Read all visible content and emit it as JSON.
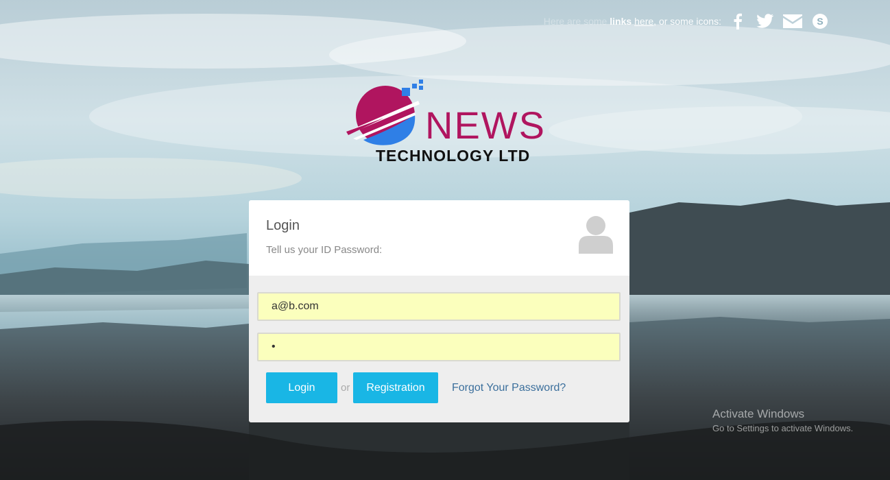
{
  "topnav": {
    "faded_text": "Here are some",
    "bold_text": "links",
    "link_text": "here",
    "rest_text": ", or some icons:",
    "icons": [
      "facebook-icon",
      "twitter-icon",
      "envelope-icon",
      "skype-icon"
    ]
  },
  "logo": {
    "word": "NEWS",
    "subtitle": "TECHNOLOGY LTD"
  },
  "login_card": {
    "title": "Login",
    "subtitle": "Tell us your ID Password:",
    "email_value": "a@b.com",
    "password_value": "•",
    "login_button": "Login",
    "or_text": "or",
    "registration_button": "Registration",
    "forgot_link": "Forgot Your Password?"
  },
  "watermark": {
    "title": "Activate Windows",
    "subtitle": "Go to Settings to activate Windows."
  },
  "colors": {
    "button": "#19b6e5",
    "input_bg": "#fbffbd",
    "brand_magenta": "#b0155f",
    "brand_blue": "#2f7fe6",
    "link": "#3b6f9c"
  }
}
